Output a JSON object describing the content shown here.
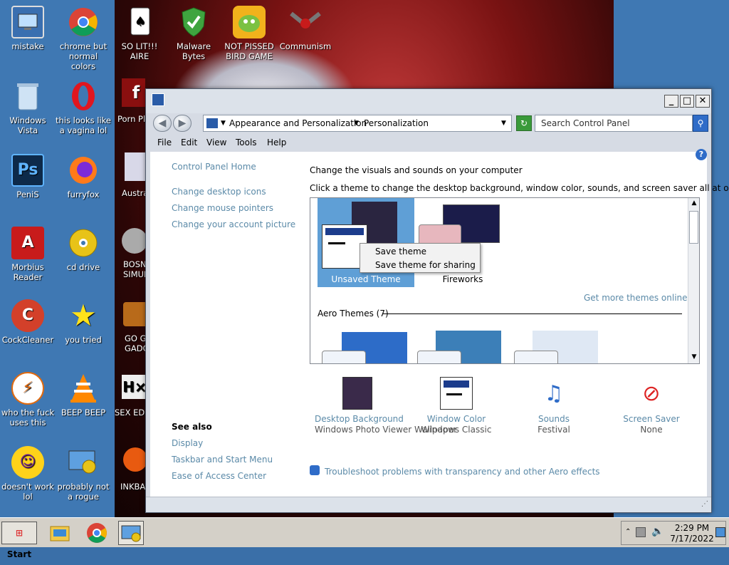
{
  "desktop": {
    "icons_left": [
      {
        "label": "mistake",
        "icon": "monitor-icon"
      },
      {
        "label": "Windows Vista",
        "icon": "recycle-bin-icon"
      },
      {
        "label": "PeniS",
        "icon": "photoshop-icon"
      },
      {
        "label": "Morbius Reader",
        "icon": "adobe-reader-icon"
      },
      {
        "label": "CockCleaner",
        "icon": "ccleaner-icon"
      },
      {
        "label": "who the fuck uses this",
        "icon": "avast-icon"
      },
      {
        "label": "doesn't work lol",
        "icon": "yahoo-messenger-icon"
      }
    ],
    "icons_col2": [
      {
        "label": "chrome but normal colors",
        "icon": "chrome-icon"
      },
      {
        "label": "this looks like a vagina lol",
        "icon": "opera-icon"
      },
      {
        "label": "furryfox",
        "icon": "firefox-icon"
      },
      {
        "label": "cd drive",
        "icon": "cd-drive-icon"
      },
      {
        "label": "you tried",
        "icon": "star-icon"
      },
      {
        "label": "BEEP BEEP",
        "icon": "vlc-icon"
      },
      {
        "label": "probably not a rogue",
        "icon": "control-panel-icon"
      }
    ],
    "icons_top": [
      {
        "label": "SO LIT!!! AIRE",
        "icon": "solitaire-icon"
      },
      {
        "label": "Malware Bytes",
        "icon": "malwarebytes-icon"
      },
      {
        "label": "NOT PISSED BIRD GAME",
        "icon": "angry-birds-icon"
      },
      {
        "label": "Communism",
        "icon": "communism-icon"
      }
    ],
    "icons_clipped": [
      {
        "label": "Porn Pl",
        "icon": "flash-player-icon"
      },
      {
        "label": "Austra",
        "icon": "game-icon"
      },
      {
        "label": "BOSN SIMULA",
        "icon": "gear-game-icon"
      },
      {
        "label": "GO G GADGE",
        "icon": "briefcase-icon"
      },
      {
        "label": "SEX EDIT",
        "icon": "hex-editor-icon"
      },
      {
        "label": "INKBA",
        "icon": "ink-icon"
      }
    ]
  },
  "window": {
    "nav": {
      "back_glyph": "◀",
      "forward_glyph": "▶",
      "breadcrumb": [
        "Appearance and Personalization",
        "Personalization"
      ],
      "refresh_glyph": "↻",
      "search_placeholder": "Search Control Panel",
      "search_glyph": "⚲"
    },
    "menu": [
      "File",
      "Edit",
      "View",
      "Tools",
      "Help"
    ],
    "sidebar": {
      "links": [
        "Control Panel Home",
        "Change desktop icons",
        "Change mouse pointers",
        "Change your account picture"
      ],
      "see_also_title": "See also",
      "see_also": [
        "Display",
        "Taskbar and Start Menu",
        "Ease of Access Center"
      ]
    },
    "main": {
      "heading": "Change the visuals and sounds on your computer",
      "subheading": "Click a theme to change the desktop background, window color, sounds, and screen saver all at once.",
      "my_themes": [
        {
          "label": "Unsaved Theme",
          "selected": true
        },
        {
          "label": "Fireworks",
          "selected": false
        }
      ],
      "get_more_link": "Get more themes online",
      "aero_section": "Aero Themes (7)",
      "context_menu": [
        "Save theme",
        "Save theme for sharing"
      ],
      "bottom_items": [
        {
          "title": "Desktop Background",
          "subtitle": "Windows Photo Viewer Wallpaper",
          "icon": "wallpaper-icon"
        },
        {
          "title": "Window Color",
          "subtitle": "Windows Classic",
          "icon": "window-color-icon"
        },
        {
          "title": "Sounds",
          "subtitle": "Festival",
          "icon": "sounds-icon"
        },
        {
          "title": "Screen Saver",
          "subtitle": "None",
          "icon": "screen-saver-icon"
        }
      ],
      "troubleshoot_link": "Troubleshoot problems with transparency and other Aero effects"
    }
  },
  "taskbar": {
    "start_label": "Start",
    "pinned": [
      {
        "icon": "file-explorer-icon"
      },
      {
        "icon": "chrome-icon"
      },
      {
        "icon": "control-panel-icon",
        "active": true
      }
    ],
    "clock_time": "2:29 PM",
    "clock_date": "7/17/2022"
  }
}
